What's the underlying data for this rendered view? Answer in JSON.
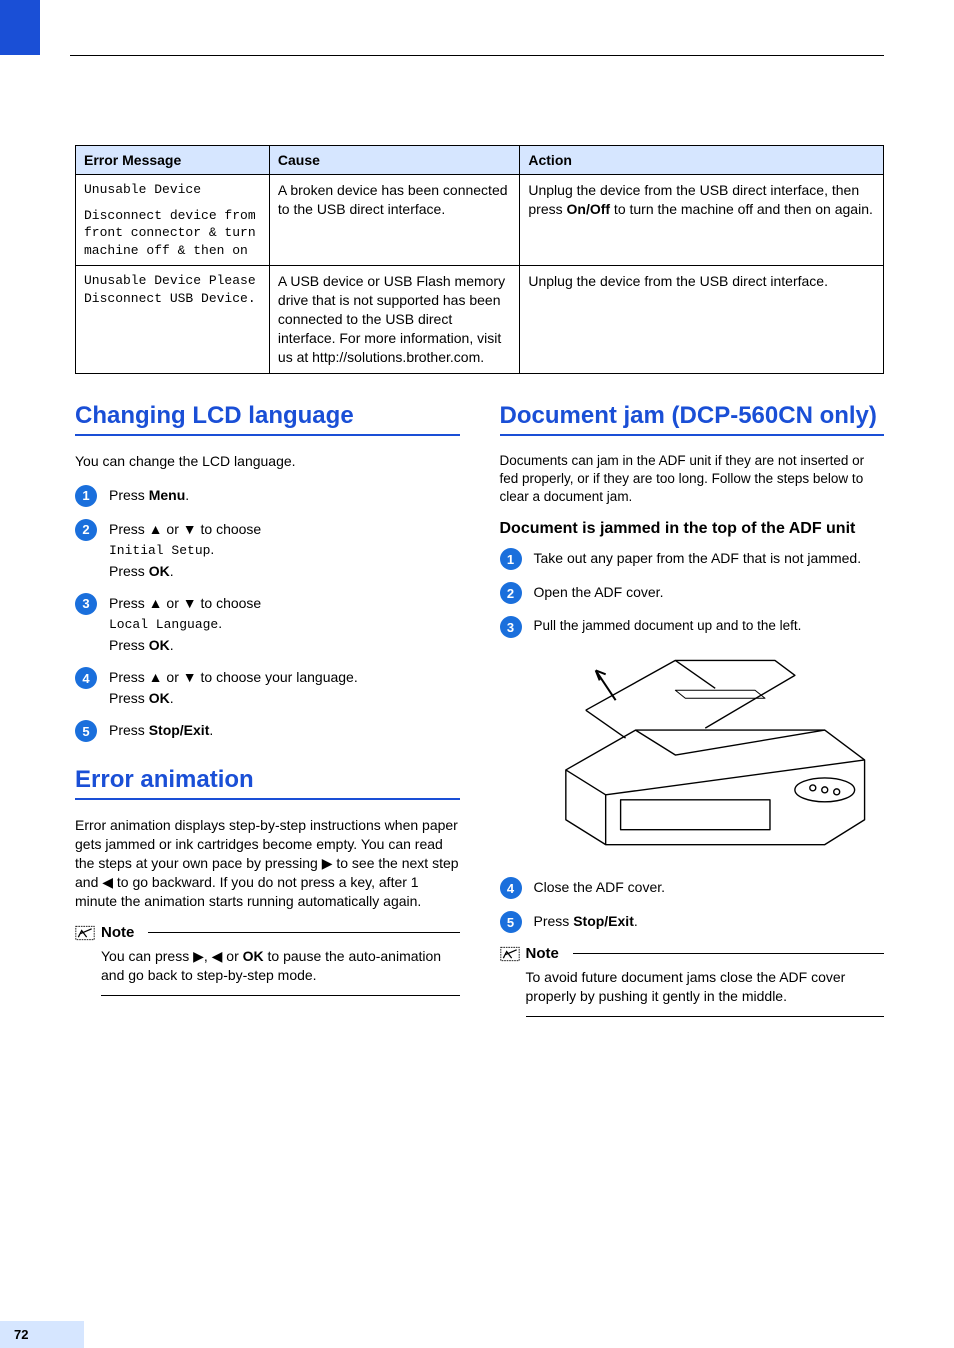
{
  "page_number": "72",
  "table": {
    "headers": [
      "Error Message",
      "Cause",
      "Action"
    ],
    "rows": [
      {
        "msg_line1": "Unusable Device",
        "msg_line2": "Disconnect device from front connector & turn machine off & then on",
        "cause": "A broken device has been connected to the USB direct interface.",
        "action_pre": "Unplug the device from the USB direct interface, then press ",
        "action_bold": "On/Off",
        "action_post": " to turn the machine off and then on again."
      },
      {
        "msg_line1": "Unusable Device Please Disconnect USB Device.",
        "msg_line2": "",
        "cause": "A USB device or USB Flash memory drive that  is not supported has been connected to the USB direct interface. For more information, visit us at http://solutions.brother.com.",
        "action_pre": "Unplug the device from the USB direct interface.",
        "action_bold": "",
        "action_post": ""
      }
    ]
  },
  "left": {
    "h_lang": "Changing LCD language",
    "lang_intro": "You can change the LCD language.",
    "steps_lang": [
      {
        "pre": "Press ",
        "b1": "Menu",
        "post": "."
      },
      {
        "pre": "Press ▲ or ▼ to choose ",
        "code": "Initial Setup",
        "post2_pre": ".\nPress ",
        "b1": "OK",
        "post": "."
      },
      {
        "pre": "Press ▲ or ▼ to choose ",
        "code": "Local Language",
        "post2_pre": ".\nPress ",
        "b1": "OK",
        "post": "."
      },
      {
        "pre": "Press ▲ or ▼ to choose your language.\nPress ",
        "b1": "OK",
        "post": "."
      },
      {
        "pre": "Press ",
        "b1": "Stop/Exit",
        "post": "."
      }
    ],
    "h_err": "Error animation",
    "err_body": "Error animation displays step-by-step instructions when paper gets jammed or ink cartridges become empty. You can read the steps at your own pace by pressing ▶ to see the next step and ◀ to go backward. If you do not press a key, after 1 minute the animation starts running automatically again.",
    "note_label": "Note",
    "note_body_pre": "You can press ▶, ◀ or ",
    "note_body_b": "OK",
    "note_body_post": " to pause the auto-animation and go back to step-by-step mode."
  },
  "right": {
    "h_jam": "Document jam (DCP-560CN only)",
    "jam_intro": "Documents can jam in the ADF unit if they are not inserted or fed properly, or if they are too long. Follow the steps below to clear a document jam.",
    "sub": "Document is jammed in the top of the ADF unit",
    "steps": [
      "Take out any paper from the ADF that is not jammed.",
      "Open the ADF cover.",
      "Pull the jammed document up and to the left."
    ],
    "step4": "Close the ADF cover.",
    "step5_pre": "Press ",
    "step5_b": "Stop/Exit",
    "step5_post": ".",
    "note_label": "Note",
    "note_body": "To avoid future document jams close the ADF cover properly by pushing it gently in the middle."
  }
}
